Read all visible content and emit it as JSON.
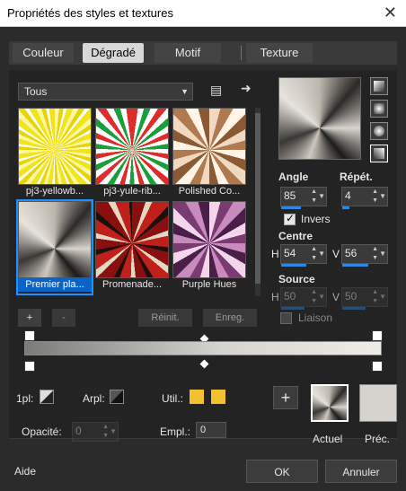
{
  "window": {
    "title": "Propriétés des styles et textures"
  },
  "tabs": [
    {
      "label": "Couleur"
    },
    {
      "label": "Dégradé"
    },
    {
      "label": "Motif"
    },
    {
      "label": "Texture"
    }
  ],
  "gradient_selector": {
    "value": "Tous"
  },
  "thumbnails": [
    {
      "label": "pj3-yellowb..."
    },
    {
      "label": "pj3-yule-rib..."
    },
    {
      "label": "Polished Co..."
    },
    {
      "label": "Premier pla..."
    },
    {
      "label": "Promenade..."
    },
    {
      "label": "Purple Hues"
    }
  ],
  "actions": {
    "add": "+",
    "remove": "-",
    "reset": "Réinit.",
    "save": "Enreg."
  },
  "params": {
    "angle_label": "Angle",
    "angle_value": "85",
    "repeat_label": "Répét.",
    "repeat_value": "4",
    "invert_label": "Invers",
    "center_label": "Centre",
    "h_label": "H",
    "v_label": "V",
    "center_h": "54",
    "center_v": "56",
    "source_label": "Source",
    "source_h": "50",
    "source_v": "50",
    "link_label": "Liaison"
  },
  "bottom": {
    "prem_label": "1pl:",
    "arr_label": "Arpl:",
    "util_label": "Util.:",
    "opacity_label": "Opacité:",
    "opacity_value": "0",
    "empl_label": "Empl.:",
    "empl_value": "0",
    "current_label": "Actuel",
    "previous_label": "Préc."
  },
  "footer": {
    "help": "Aide",
    "ok": "OK",
    "cancel": "Annuler"
  },
  "colors": {
    "accent": "#2e86de",
    "gold": "#f2c12e"
  }
}
